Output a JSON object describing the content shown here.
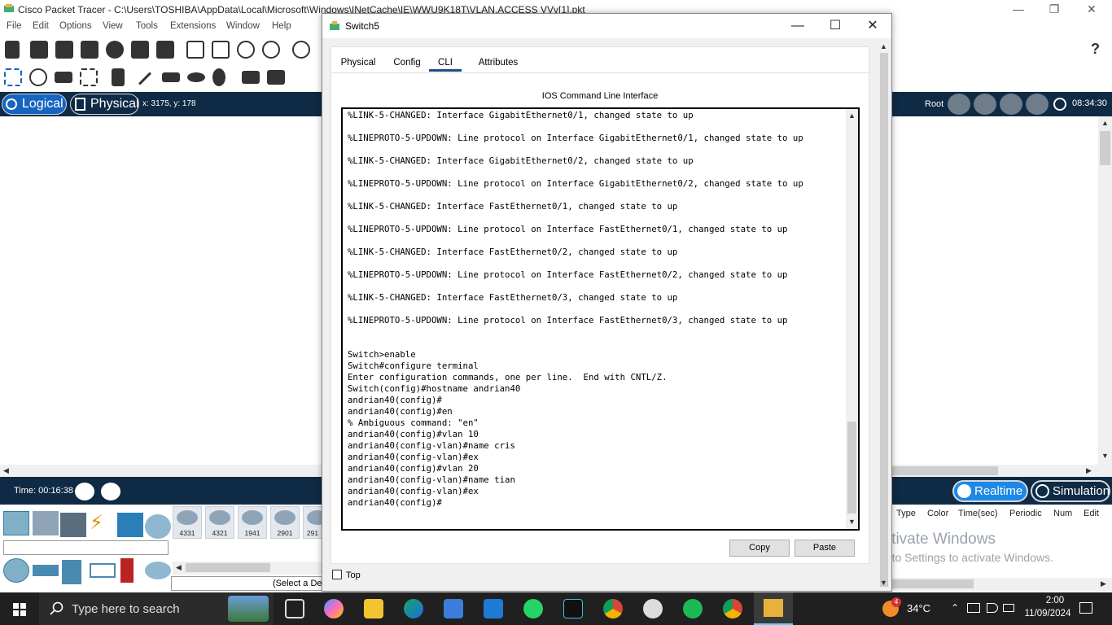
{
  "main_window": {
    "title": "Cisco Packet Tracer - C:\\Users\\TOSHIBA\\AppData\\Local\\Microsoft\\Windows\\INetCache\\IE\\WWU9K18T\\VLAN.ACCESS VVv[1].pkt",
    "minimize": "—",
    "maximize": "❐",
    "close": "✕"
  },
  "menu": [
    "File",
    "Edit",
    "Options",
    "View",
    "Tools",
    "Extensions",
    "Window",
    "Help"
  ],
  "help_icon": "?",
  "navbar": {
    "logical": "Logical",
    "physical": "Physical",
    "coords": "x: 3175, y: 178",
    "root": "Root",
    "clock": "08:34:30"
  },
  "simbar": {
    "time": "Time: 00:16:38",
    "realtime": "Realtime",
    "simulation": "Simulation"
  },
  "device_models": [
    "4331",
    "4321",
    "1941",
    "2901",
    "291"
  ],
  "device_status": "(Select a De",
  "event_columns": [
    "Type",
    "Color",
    "Time(sec)",
    "Periodic",
    "Num",
    "Edit"
  ],
  "watermark": {
    "line1": "Activate Windows",
    "line2": "Go to Settings to activate Windows."
  },
  "dialog": {
    "title": "Switch5",
    "minimize": "—",
    "maximize": "☐",
    "close": "✕",
    "tabs": [
      "Physical",
      "Config",
      "CLI",
      "Attributes"
    ],
    "active_tab": "CLI",
    "heading": "IOS Command Line Interface",
    "console_output": "%LINK-5-CHANGED: Interface GigabitEthernet0/1, changed state to up\n\n%LINEPROTO-5-UPDOWN: Line protocol on Interface GigabitEthernet0/1, changed state to up\n\n%LINK-5-CHANGED: Interface GigabitEthernet0/2, changed state to up\n\n%LINEPROTO-5-UPDOWN: Line protocol on Interface GigabitEthernet0/2, changed state to up\n\n%LINK-5-CHANGED: Interface FastEthernet0/1, changed state to up\n\n%LINEPROTO-5-UPDOWN: Line protocol on Interface FastEthernet0/1, changed state to up\n\n%LINK-5-CHANGED: Interface FastEthernet0/2, changed state to up\n\n%LINEPROTO-5-UPDOWN: Line protocol on Interface FastEthernet0/2, changed state to up\n\n%LINK-5-CHANGED: Interface FastEthernet0/3, changed state to up\n\n%LINEPROTO-5-UPDOWN: Line protocol on Interface FastEthernet0/3, changed state to up\n\n\nSwitch>enable\nSwitch#configure terminal\nEnter configuration commands, one per line.  End with CNTL/Z.\nSwitch(config)#hostname andrian40\nandrian40(config)#\nandrian40(config)#en\n% Ambiguous command: \"en\"\nandrian40(config)#vlan 10\nandrian40(config-vlan)#name cris\nandrian40(config-vlan)#ex\nandrian40(config)#vlan 20\nandrian40(config-vlan)#name tian\nandrian40(config-vlan)#ex\nandrian40(config)#",
    "copy": "Copy",
    "paste": "Paste",
    "top_checkbox": "Top"
  },
  "taskbar": {
    "search_placeholder": "Type here to search",
    "temperature": "34°C",
    "weather_badge": "4",
    "time": "2:00",
    "date": "11/09/2024"
  },
  "colors": {
    "navbar_bg": "#0f2a44",
    "logical_active": "#1565c0",
    "realtime_active": "#1e88e5",
    "taskbar_bg": "#202020"
  }
}
